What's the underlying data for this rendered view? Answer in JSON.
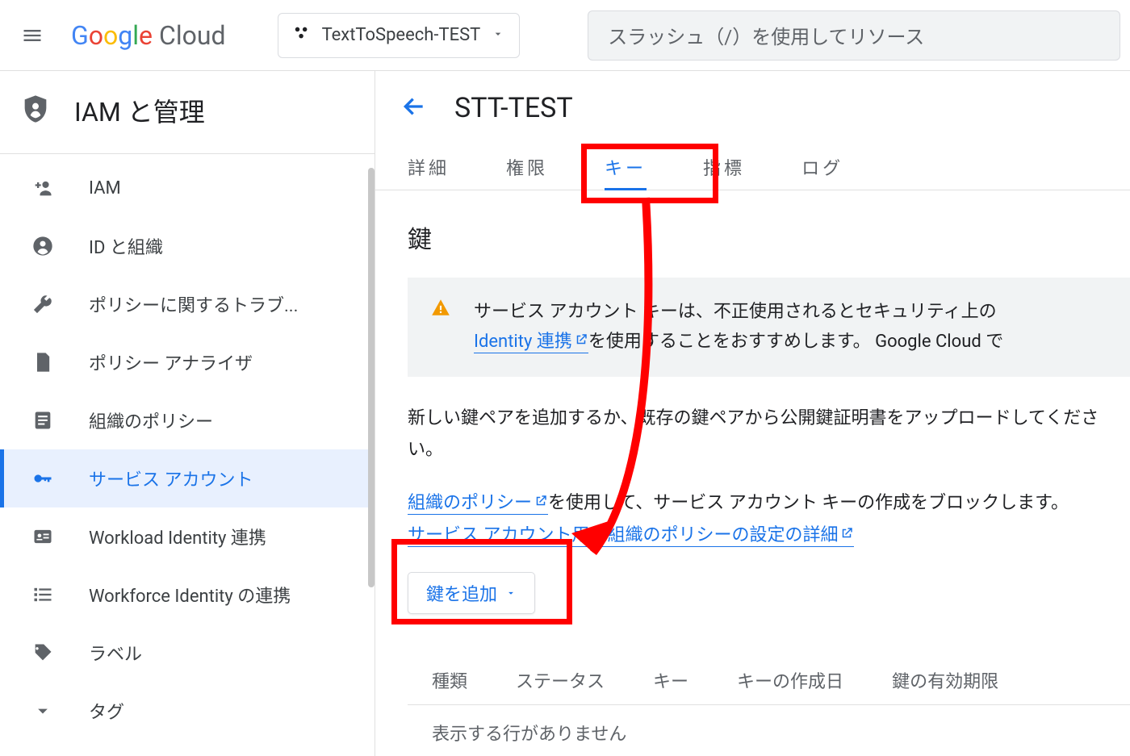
{
  "header": {
    "logo_text_google": "Google",
    "logo_text_cloud": "Cloud",
    "project_name": "TextToSpeech-TEST",
    "search_placeholder": "スラッシュ（/）を使用してリソース"
  },
  "sidebar": {
    "title": "IAM と管理",
    "items": [
      {
        "icon": "person-plus-icon",
        "label": "IAM"
      },
      {
        "icon": "person-circle-icon",
        "label": "ID と組織"
      },
      {
        "icon": "wrench-icon",
        "label": "ポリシーに関するトラブ..."
      },
      {
        "icon": "doc-search-icon",
        "label": "ポリシー アナライザ"
      },
      {
        "icon": "doc-lines-icon",
        "label": "組織のポリシー"
      },
      {
        "icon": "key-icon",
        "label": "サービス アカウント"
      },
      {
        "icon": "id-card-icon",
        "label": "Workload Identity 連携"
      },
      {
        "icon": "list-icon",
        "label": "Workforce Identity の連携"
      },
      {
        "icon": "tag-icon",
        "label": "ラベル"
      },
      {
        "icon": "chevron-down-icon",
        "label": "タグ"
      }
    ],
    "active_index": 5
  },
  "main": {
    "page_title": "STT-TEST",
    "tabs": [
      {
        "label": "詳細"
      },
      {
        "label": "権限"
      },
      {
        "label": "キー"
      },
      {
        "label": "指標"
      },
      {
        "label": "ログ"
      }
    ],
    "active_tab_index": 2,
    "section_heading": "鍵",
    "warning": {
      "line1_pre": "サービス アカウント キーは、不正使用されるとセキュリティ上の",
      "link_text": "Identity 連携",
      "line2_post": "を使用することをおすすめします。 Google Cloud で"
    },
    "body_paragraph": "新しい鍵ペアを追加するか、既存の鍵ペアから公開鍵証明書をアップロードしてください。",
    "policy_text": {
      "link1": "組織のポリシー",
      "mid": "を使用して、サービス アカウント キーの作成をブロックします。",
      "link2": "サービス アカウント用の組織のポリシーの設定の詳細"
    },
    "add_key_button": "鍵を追加",
    "table": {
      "columns": [
        "種類",
        "ステータス",
        "キー",
        "キーの作成日",
        "鍵の有効期限"
      ],
      "empty_text": "表示する行がありません"
    }
  }
}
